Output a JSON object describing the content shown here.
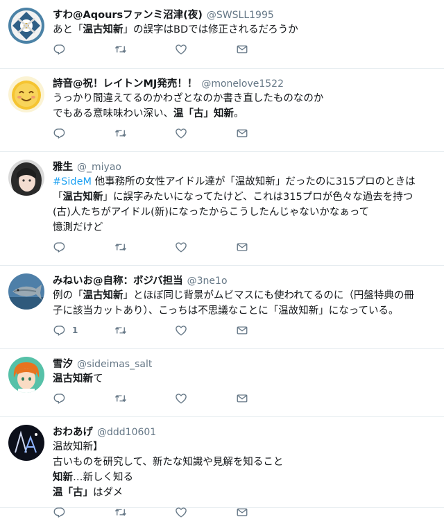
{
  "colors": {
    "text": "#14171a",
    "secondary": "#657786",
    "link": "#1da1f2",
    "border": "#e6ecf0"
  },
  "icons": [
    "reply-icon",
    "retweet-icon",
    "like-icon",
    "dm-icon"
  ],
  "tweets": [
    {
      "name": "すわ@Aqoursファンミ沼津(夜)",
      "handle": "@SWSLL1995",
      "lines": [
        [
          {
            "t": "あと「"
          },
          {
            "t": "温古知新",
            "s": "b"
          },
          {
            "t": "」の誤字はBDでは修正されるだろうか"
          }
        ]
      ],
      "reply_count": ""
    },
    {
      "name": "詩音@祝！レイトンMJ発売！！",
      "handle": "@monelove1522",
      "lines": [
        [
          {
            "t": "うっかり間違えてるのかわざとなのか書き直したものなのか"
          }
        ],
        [
          {
            "t": "でもある意味味わい深い、"
          },
          {
            "t": "温「古」知新",
            "s": "b"
          },
          {
            "t": "。"
          }
        ]
      ],
      "reply_count": ""
    },
    {
      "name": "雅生",
      "handle": "@_miyao",
      "lines": [
        [
          {
            "t": "#SideM",
            "s": "tag"
          },
          {
            "t": " 他事務所の女性アイドル達が「温故知新」だったのに315プロのときは"
          }
        ],
        [
          {
            "t": "「"
          },
          {
            "t": "温古知新",
            "s": "b"
          },
          {
            "t": "」に誤字みたいになってたけど、これは315プロが色々な過去を持つ"
          }
        ],
        [
          {
            "t": "(古)人たちがアイドル(新)になったからこうしたんじゃないかなぁって"
          }
        ],
        [
          {
            "t": "憶測だけど"
          }
        ]
      ],
      "reply_count": ""
    },
    {
      "name": "みねいお@自称：ボジバ担当",
      "handle": "@3ne1o",
      "lines": [
        [
          {
            "t": "例の「"
          },
          {
            "t": "温古知新",
            "s": "b"
          },
          {
            "t": "」とほぼ同じ背景がムビマスにも使われてるのに（円盤特典の冊"
          }
        ],
        [
          {
            "t": "子に該当カットあり）、こっちは不思議なことに「温故知新」になっている。"
          }
        ]
      ],
      "reply_count": "1"
    },
    {
      "name": "雪汐",
      "handle": "@sideimas_salt",
      "lines": [
        [
          {
            "t": "温古知新",
            "s": "b"
          },
          {
            "t": "て"
          }
        ]
      ],
      "reply_count": ""
    },
    {
      "name": "おわあげ",
      "handle": "@ddd10601",
      "lines": [
        [
          {
            "t": "温故知新】"
          }
        ],
        [
          {
            "t": "古いものを研究して、新たな知識や見解を知ること"
          }
        ],
        [
          {
            "t": "知新",
            "s": "b"
          },
          {
            "t": "…新しく知る"
          }
        ],
        [
          {
            "t": "温「古」",
            "s": "b"
          },
          {
            "t": "はダメ"
          }
        ]
      ],
      "reply_count": ""
    }
  ]
}
